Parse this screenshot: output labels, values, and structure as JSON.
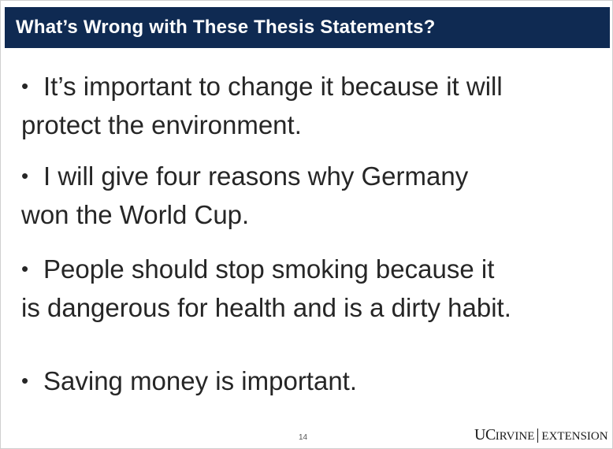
{
  "slide": {
    "title": "What’s Wrong with These Thesis Statements?",
    "bullet_glyph": "•",
    "bullets": [
      {
        "line1": "It’s important to change it because it will",
        "line2": "protect the environment."
      },
      {
        "line1": "I will give four reasons why Germany",
        "line2": "won the World Cup."
      },
      {
        "line1": "People should stop smoking because it",
        "line2": "is dangerous for health and is a dirty habit."
      },
      {
        "line1": "Saving money is important.",
        "line2": ""
      }
    ],
    "page_number": "14"
  },
  "logo": {
    "uc": "UC",
    "irvine": "IRVINE",
    "extension": "EXTENSION"
  },
  "colors": {
    "title_bar": "#0f2a52",
    "title_text": "#ffffff",
    "body_text": "#262626"
  }
}
